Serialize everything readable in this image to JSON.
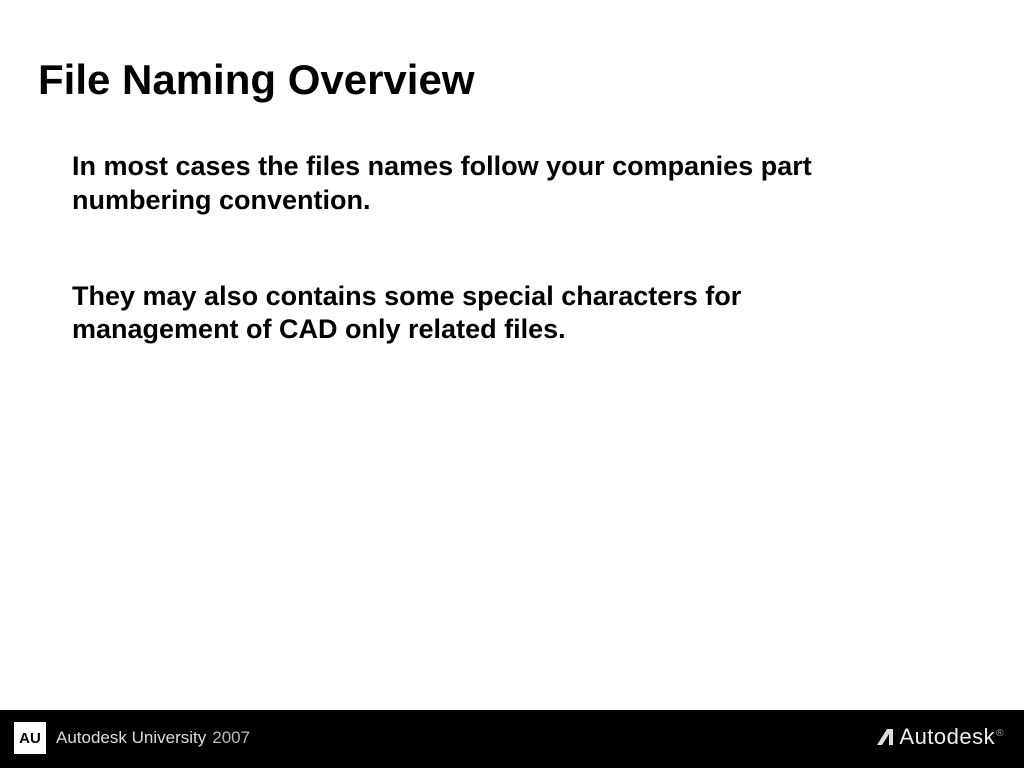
{
  "title": "File Naming Overview",
  "paragraphs": [
    "In most cases the files names follow your companies part numbering convention.",
    "They may also contains some special characters for management of CAD only related files."
  ],
  "footer": {
    "badge": "AU",
    "label": "Autodesk University",
    "year": "2007",
    "brand": "Autodesk",
    "reg": "®"
  }
}
